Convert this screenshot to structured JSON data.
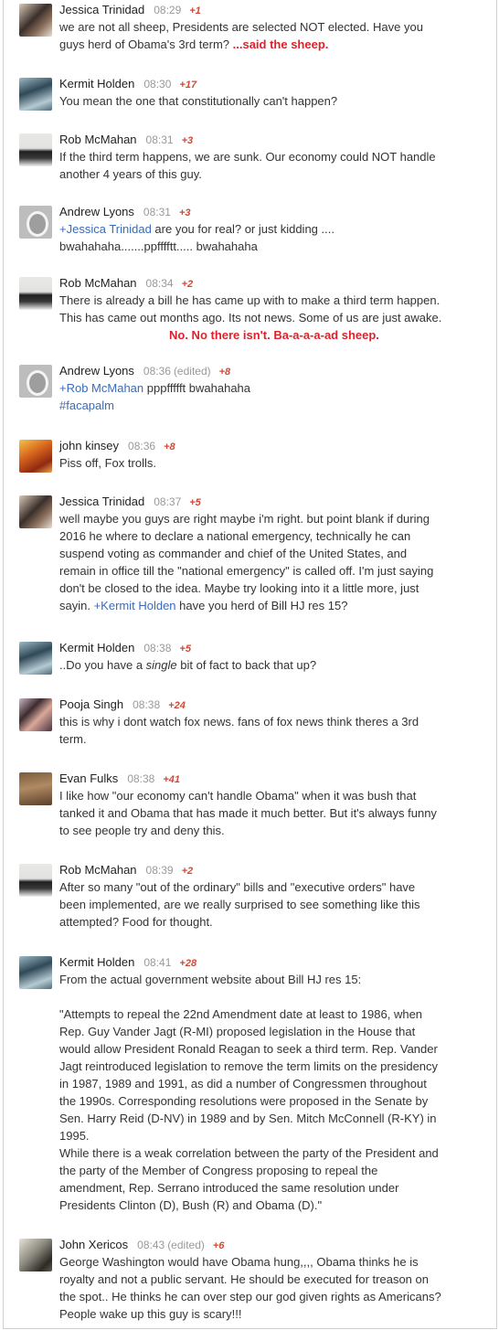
{
  "comments": [
    {
      "author": "Jessica Trinidad",
      "time": "08:29",
      "edited": "",
      "score": "+1",
      "avatar_icon": "profile-photo-icon",
      "lines": [
        "we are not all sheep, Presidents are selected NOT elected.  Have you",
        "guys herd of Obama's 3rd term? "
      ],
      "note": "...said the sheep."
    },
    {
      "author": "Kermit Holden",
      "time": "08:30",
      "edited": "",
      "score": "+17",
      "avatar_icon": "profile-photo-icon",
      "lines": [
        "You mean the one that constitutionally can't happen?"
      ]
    },
    {
      "author": "Rob McMahan",
      "time": "08:31",
      "edited": "",
      "score": "+3",
      "avatar_icon": "profile-photo-icon",
      "lines": [
        "If the third term happens, we are sunk. Our economy could NOT handle",
        "another 4 years of this guy."
      ]
    },
    {
      "author": "Andrew Lyons",
      "time": "08:31",
      "edited": "",
      "score": "+3",
      "avatar_icon": "default-avatar-icon",
      "mention": "+Jessica Trinidad",
      "lines": [
        " are you for real? or just kidding ....",
        "bwahahaha.......ppfffftt..... bwahahaha"
      ]
    },
    {
      "author": "Rob McMahan",
      "time": "08:34",
      "edited": "",
      "score": "+2",
      "avatar_icon": "profile-photo-icon",
      "lines": [
        "There is already a bill he has came up with to make a third term happen.",
        "This has came out months ago. Its not news. Some of us are just awake."
      ],
      "note": "No. No there isn't. Ba-a-a-a-ad sheep."
    },
    {
      "author": "Andrew Lyons",
      "time": "08:36",
      "edited": "(edited)",
      "score": "+8",
      "avatar_icon": "default-avatar-icon",
      "mention": "+Rob McMahan",
      "lines": [
        " pppffffft bwahahaha"
      ],
      "hashtag": "#facapalm"
    },
    {
      "author": "john kinsey",
      "time": "08:36",
      "edited": "",
      "score": "+8",
      "avatar_icon": "profile-photo-icon",
      "lines": [
        "Piss off, Fox trolls."
      ]
    },
    {
      "author": "Jessica Trinidad",
      "time": "08:37",
      "edited": "",
      "score": "+5",
      "avatar_icon": "profile-photo-icon",
      "lines": [
        "well maybe you guys are right maybe i'm right.  but point blank if during",
        "2016 he where to declare a national emergency, technically he can",
        "suspend voting as commander and chief of the United States, and",
        "remain in office till the \"national emergency\" is called off. I'm just saying",
        "don't be closed to the idea. Maybe try looking into it a little more, just",
        "sayin. "
      ],
      "mention_inline": "+Kermit Holden",
      "after_mention": " have you herd of Bill HJ res 15?"
    },
    {
      "author": "Kermit Holden",
      "time": "08:38",
      "edited": "",
      "score": "+5",
      "avatar_icon": "profile-photo-icon",
      "pre": "..Do you have a ",
      "em": "single",
      "post": " bit of fact to back that up?"
    },
    {
      "author": "Pooja Singh",
      "time": "08:38",
      "edited": "",
      "score": "+24",
      "avatar_icon": "profile-photo-icon",
      "lines": [
        "this is why i dont watch fox news. fans of fox news think theres a 3rd",
        "term."
      ]
    },
    {
      "author": "Evan Fulks",
      "time": "08:38",
      "edited": "",
      "score": "+41",
      "avatar_icon": "profile-photo-icon",
      "lines": [
        "I like how \"our economy can't handle Obama\" when it was bush that",
        "tanked it and Obama that has made it much better. But it's always funny",
        "to see people try and deny this."
      ]
    },
    {
      "author": "Rob McMahan",
      "time": "08:39",
      "edited": "",
      "score": "+2",
      "avatar_icon": "profile-photo-icon",
      "lines": [
        "After so many \"out of the ordinary\" bills and \"executive orders\" have",
        "been implemented, are we really surprised to see something like this",
        "attempted? Food for thought."
      ]
    },
    {
      "author": "Kermit Holden",
      "time": "08:41",
      "edited": "",
      "score": "+28",
      "avatar_icon": "profile-photo-icon",
      "lines": [
        "From the actual government website about Bill HJ res 15:"
      ],
      "quote": [
        "\"Attempts to repeal the 22nd Amendment date at least to 1986, when",
        "Rep. Guy Vander Jagt (R-MI) proposed legislation in the House that",
        "would allow President Ronald Reagan to seek a third term. Rep. Vander",
        "Jagt reintroduced legislation to remove the term limits on the presidency",
        "in 1987, 1989 and 1991, as did a number of Congressmen throughout",
        "the 1990s. Corresponding resolutions were proposed in the Senate by",
        "Sen. Harry Reid (D-NV) in 1989 and by Sen. Mitch McConnell (R-KY) in",
        "1995.",
        "While there is a weak correlation between the party of the President and",
        "the party of the Member of Congress proposing to repeal the",
        "amendment, Rep. Serrano introduced the same resolution under",
        "Presidents Clinton (D), Bush (R) and Obama (D).\""
      ]
    },
    {
      "author": "John Xericos",
      "time": "08:43",
      "edited": "(edited)",
      "score": "+6",
      "avatar_icon": "profile-photo-icon",
      "lines": [
        "George Washington would have Obama hung,,,, Obama thinks he is",
        "royalty and not a public servant. He should be executed for treason on",
        "the spot.. He thinks he can over step our god given rights as Americans?",
        "People wake up this guy is scary!!!"
      ]
    }
  ]
}
